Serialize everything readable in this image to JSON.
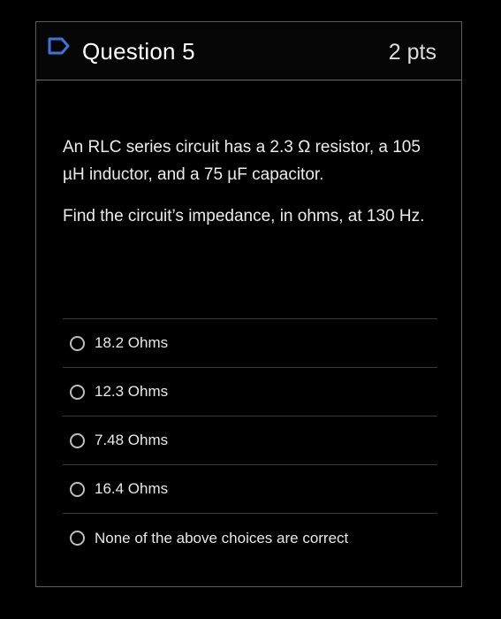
{
  "question": {
    "title": "Question 5",
    "points": "2 pts",
    "flag_icon": "flag-outline-icon",
    "flag_color": "#3b76d6",
    "paragraphs": [
      "An RLC series circuit has a 2.3 Ω resistor, a 105 µH inductor, and a 75 µF capacitor.",
      "Find the circuit’s impedance, in ohms, at 130 Hz."
    ],
    "answers": [
      {
        "label": "18.2 Ohms",
        "selected": false
      },
      {
        "label": "12.3 Ohms",
        "selected": false
      },
      {
        "label": "7.48 Ohms",
        "selected": false
      },
      {
        "label": "16.4 Ohms",
        "selected": false
      },
      {
        "label": "None of the above choices are correct",
        "selected": false
      }
    ]
  }
}
